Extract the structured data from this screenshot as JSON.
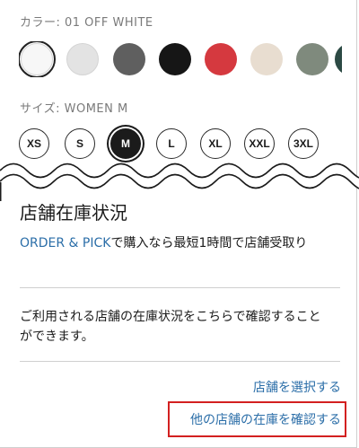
{
  "color_section": {
    "label": "カラー: 01 OFF WHITE",
    "swatches": [
      {
        "name": "off-white",
        "color": "#f7f7f7",
        "selected": true
      },
      {
        "name": "light-gray",
        "color": "#e3e3e3"
      },
      {
        "name": "gray",
        "color": "#5f5f5f"
      },
      {
        "name": "black",
        "color": "#161616"
      },
      {
        "name": "red",
        "color": "#d5393f"
      },
      {
        "name": "beige",
        "color": "#e8ddd0"
      },
      {
        "name": "olive-gray",
        "color": "#7f8a7d"
      },
      {
        "name": "dark-green",
        "color": "#2c4a44"
      }
    ]
  },
  "size_section": {
    "label": "サイズ: WOMEN M",
    "sizes": [
      "XS",
      "S",
      "M",
      "L",
      "XL",
      "XXL",
      "3XL"
    ],
    "selected": "M"
  },
  "stock": {
    "title": "店舗在庫状況",
    "order_pick_link": "ORDER & PICK",
    "order_pick_text": "で購入なら最短1時間で店舗受取り",
    "info_text": "ご利用される店舗の在庫状況をこちらで確認することができます。",
    "select_store_link": "店舗を選択する",
    "check_other_stores_link": "他の店舗の在庫を確認する"
  },
  "colors": {
    "link": "#2b6ea8",
    "highlight": "#d32020"
  }
}
